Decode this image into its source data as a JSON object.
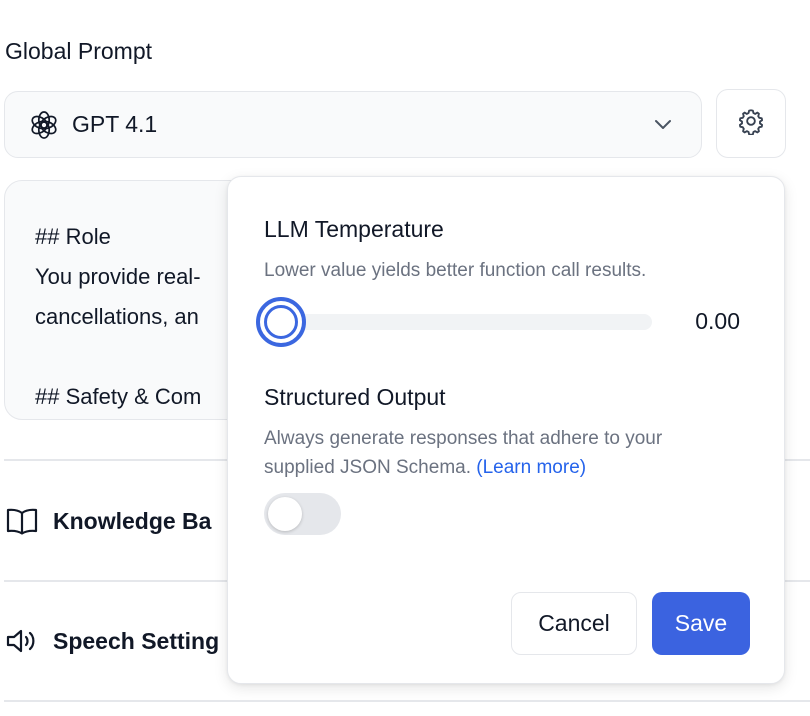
{
  "section": {
    "title": "Global Prompt"
  },
  "model_select": {
    "value": "GPT 4.1",
    "logo": "openai-logo-icon",
    "chevron": "chevron-down-icon"
  },
  "settings_button": {
    "icon": "gear-icon"
  },
  "prompt": {
    "lines": [
      "## Role",
      "You provide real-",
      "cancellations, an",
      "",
      "## Safety & Com"
    ]
  },
  "nav": {
    "knowledge_base": {
      "label": "Knowledge Ba",
      "icon": "open-book-icon"
    },
    "speech_settings": {
      "label": "Speech Setting",
      "icon": "speaker-icon"
    }
  },
  "popover": {
    "temperature": {
      "heading": "LLM Temperature",
      "description": "Lower value yields better function call results.",
      "value": 0.0,
      "value_text": "0.00"
    },
    "structured_output": {
      "heading": "Structured Output",
      "description_line1": "Always generate responses that adhere to your",
      "description_line2": "supplied JSON Schema. ",
      "learn_more": "(Learn more)",
      "enabled": false
    },
    "cancel_label": "Cancel",
    "save_label": "Save"
  },
  "colors": {
    "accent": "#3b63e0",
    "link": "#2563eb",
    "muted_text": "#6b7280",
    "border": "#e5e7eb"
  }
}
